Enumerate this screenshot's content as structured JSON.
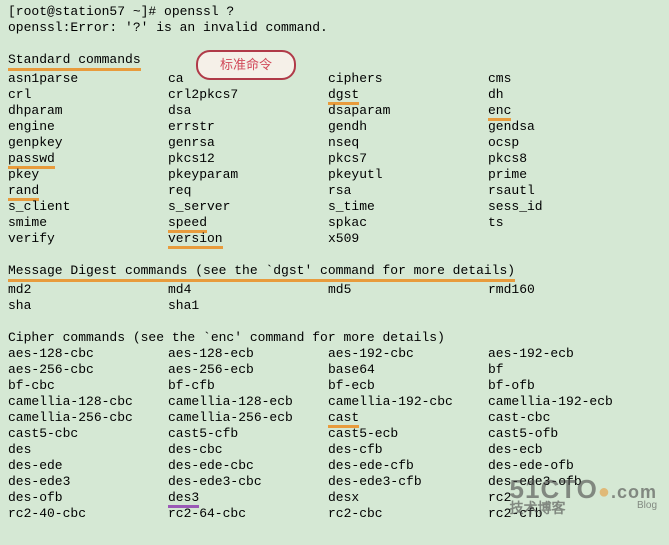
{
  "prompt": "[root@station57 ~]# openssl ?",
  "error": "openssl:Error: '?' is an invalid command.",
  "callout": "标准命令",
  "sections": {
    "standard": {
      "title": "Standard commands",
      "rows": [
        [
          "asn1parse",
          "ca",
          "ciphers",
          "cms"
        ],
        [
          "crl",
          "crl2pkcs7",
          "dgst",
          "dh"
        ],
        [
          "dhparam",
          "dsa",
          "dsaparam",
          "enc"
        ],
        [
          "engine",
          "errstr",
          "gendh",
          "gendsa"
        ],
        [
          "genpkey",
          "genrsa",
          "nseq",
          "ocsp"
        ],
        [
          "passwd",
          "pkcs12",
          "pkcs7",
          "pkcs8"
        ],
        [
          "pkey",
          "pkeyparam",
          "pkeyutl",
          "prime"
        ],
        [
          "rand",
          "req",
          "rsa",
          "rsautl"
        ],
        [
          "s_client",
          "s_server",
          "s_time",
          "sess_id"
        ],
        [
          "smime",
          "speed",
          "spkac",
          "ts"
        ],
        [
          "verify",
          "version",
          "x509",
          ""
        ]
      ]
    },
    "digest": {
      "title": "Message Digest commands (see the `dgst' command for more details)",
      "rows": [
        [
          "md2",
          "md4",
          "md5",
          "rmd160"
        ],
        [
          "sha",
          "sha1",
          "",
          ""
        ]
      ]
    },
    "cipher": {
      "title": "Cipher commands (see the `enc' command for more details)",
      "rows": [
        [
          "aes-128-cbc",
          "aes-128-ecb",
          "aes-192-cbc",
          "aes-192-ecb"
        ],
        [
          "aes-256-cbc",
          "aes-256-ecb",
          "base64",
          "bf"
        ],
        [
          "bf-cbc",
          "bf-cfb",
          "bf-ecb",
          "bf-ofb"
        ],
        [
          "camellia-128-cbc",
          "camellia-128-ecb",
          "camellia-192-cbc",
          "camellia-192-ecb"
        ],
        [
          "camellia-256-cbc",
          "camellia-256-ecb",
          "cast",
          "cast-cbc"
        ],
        [
          "cast5-cbc",
          "cast5-cfb",
          "cast5-ecb",
          "cast5-ofb"
        ],
        [
          "des",
          "des-cbc",
          "des-cfb",
          "des-ecb"
        ],
        [
          "des-ede",
          "des-ede-cbc",
          "des-ede-cfb",
          "des-ede-ofb"
        ],
        [
          "des-ede3",
          "des-ede3-cbc",
          "des-ede3-cfb",
          "des-ede3-ofb"
        ],
        [
          "des-ofb",
          "des3",
          "desx",
          "rc2"
        ],
        [
          "rc2-40-cbc",
          "rc2-64-cbc",
          "rc2-cbc",
          "rc2-cfb"
        ]
      ]
    }
  },
  "highlights": {
    "orange": [
      "Standard commands",
      "dgst",
      "enc",
      "passwd",
      "rand",
      "speed",
      "version",
      "cast"
    ],
    "purple": [
      "des3"
    ]
  },
  "watermark": {
    "main": "51CTO",
    "suffix": ".com",
    "sub": "技术博客",
    "blog": "Blog"
  }
}
